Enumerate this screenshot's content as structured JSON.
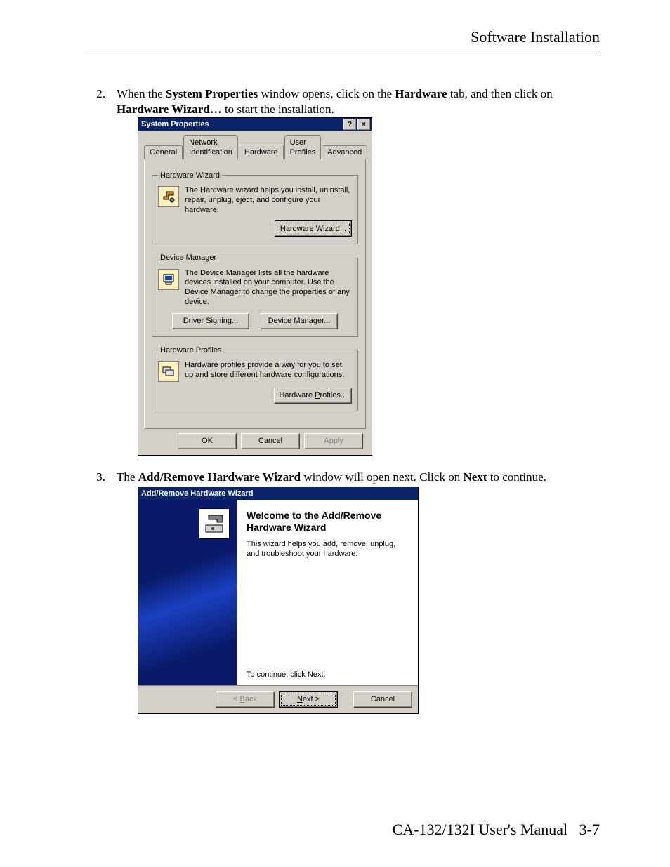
{
  "header": "Software Installation",
  "footer": {
    "left": "CA-132/132I  User's Manual",
    "page": "3-7"
  },
  "steps": {
    "s2": {
      "num": "2.",
      "text_before": "When the ",
      "b1": "System Properties",
      "t2": " window opens, click on the ",
      "b2": "Hardware",
      "t3": " tab, and then click on ",
      "b3": "Hardware Wizard…",
      "t4": " to start the installation."
    },
    "s3": {
      "num": "3.",
      "t1": "The ",
      "b1": "Add/Remove Hardware Wizard",
      "t2": " window will open next. Click on ",
      "b2": "Next",
      "t3": " to continue."
    }
  },
  "dlg1": {
    "title": "System Properties",
    "help_btn": "?",
    "close_btn": "×",
    "tabs": {
      "general": "General",
      "netid": "Network Identification",
      "hardware": "Hardware",
      "userprof": "User Profiles",
      "advanced": "Advanced"
    },
    "hwwiz": {
      "legend": "Hardware Wizard",
      "text": "The Hardware wizard helps you install, uninstall, repair, unplug, eject, and configure your hardware.",
      "button": "Hardware Wizard..."
    },
    "devmgr": {
      "legend": "Device Manager",
      "text": "The Device Manager lists all the hardware devices installed on your computer. Use the Device Manager to change the properties of any device.",
      "btn_sign": "Driver Signing...",
      "btn_dev": "Device Manager..."
    },
    "hwprof": {
      "legend": "Hardware Profiles",
      "text": "Hardware profiles provide a way for you to set up and store different hardware configurations.",
      "button": "Hardware Profiles..."
    },
    "footer": {
      "ok": "OK",
      "cancel": "Cancel",
      "apply": "Apply"
    }
  },
  "dlg2": {
    "title": "Add/Remove Hardware Wizard",
    "heading": "Welcome to the Add/Remove Hardware Wizard",
    "desc": "This wizard helps you add, remove, unplug, and troubleshoot your hardware.",
    "continue": "To continue, click Next.",
    "btn_back": "< Back",
    "btn_next": "Next >",
    "btn_cancel": "Cancel"
  }
}
